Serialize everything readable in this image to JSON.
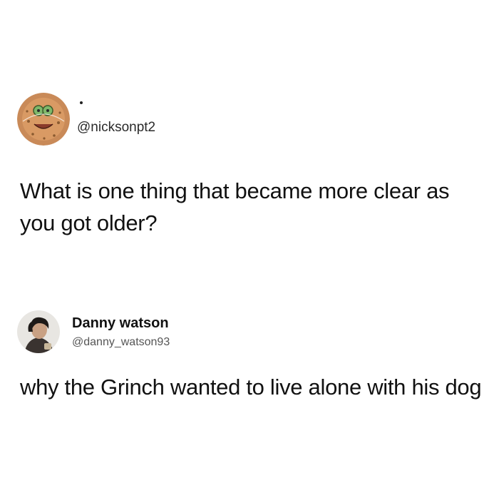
{
  "tweets": [
    {
      "avatar_icon": "cartoon-face-avatar-icon",
      "handle": "@nicksonpt2",
      "text": "What is one thing that became more clear as you got older?"
    },
    {
      "avatar_icon": "person-photo-avatar-icon",
      "display_name": "Danny watson",
      "handle": "@danny_watson93",
      "text": "why the Grinch wanted to live alone with his dog"
    }
  ]
}
